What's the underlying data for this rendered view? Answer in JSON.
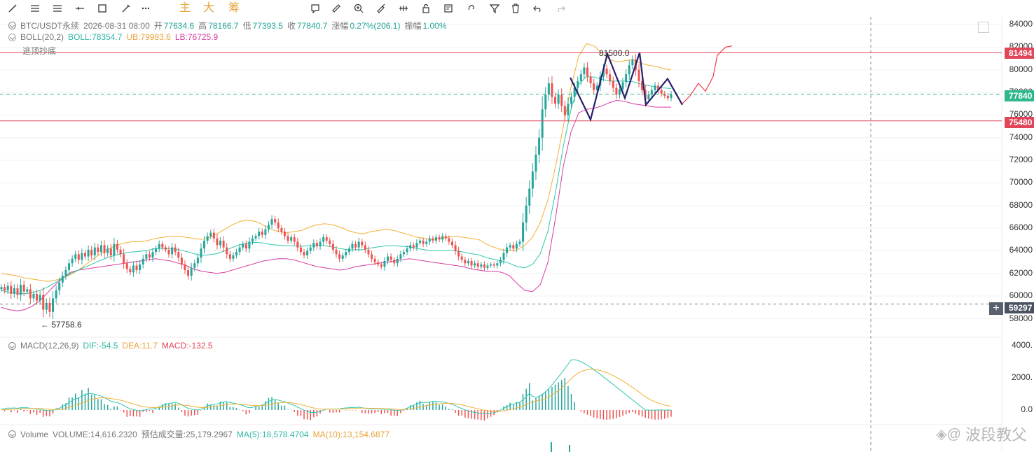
{
  "toolbar": {
    "icons": [
      "line-icon",
      "multi-line-icon",
      "parallel-lines-icon",
      "horizontal-ray-icon",
      "rectangle-icon",
      "brush-icon",
      "more-icon",
      "text-note-icon",
      "ruler-icon",
      "zoom-in-icon",
      "magnet-icon",
      "visibility-icon",
      "lock-icon",
      "note-icon",
      "link-icon",
      "filter-icon",
      "trash-icon",
      "undo-icon",
      "redo-icon"
    ],
    "labels": [
      "主",
      "大",
      "筹"
    ]
  },
  "header": {
    "symbol": "BTC/USDT永续",
    "datetime": "2026-08-31 08:00",
    "open_label": "开",
    "open": "77634.6",
    "high_label": "高",
    "high": "78166.7",
    "low_label": "低",
    "low": "77393.5",
    "close_label": "收",
    "close": "77840.7",
    "change_label": "涨幅",
    "change": "0.27%(206.1)",
    "amp_label": "振幅",
    "amp": "1.00%"
  },
  "boll": {
    "name": "BOLL(20,2)",
    "mid": "BOLL:78354.7",
    "ub": "UB:79983.6",
    "lb": "LB:76725.9",
    "indicator": "逃顶抄底"
  },
  "macd": {
    "name": "MACD(12,26,9)",
    "dif": "DIF:-54.5",
    "dea": "DEA:11.7",
    "macd": "MACD:-132.5"
  },
  "volume": {
    "name": "Volume",
    "vol": "VOLUME:14,616.2320",
    "est": "预估成交量:25,179.2967",
    "ma5": "MA(5):18,578.4704",
    "ma10": "MA(10):13,154.6877"
  },
  "price_tags": {
    "high_line": "81494",
    "current": "77840",
    "low_line": "75480",
    "cursor": "59297"
  },
  "annotations": {
    "peak": "81500.0",
    "trough": "57758.6"
  },
  "watermark": "波段教父",
  "colors": {
    "up": "#26a69a",
    "down": "#ef5350",
    "ub": "#f2b035",
    "lb": "#d63da0",
    "mid": "#2fc6ad",
    "hline": "#e0455a",
    "wave": "#2a1f6e",
    "dea": "#f2b035",
    "dif": "#2fc6ad"
  },
  "chart_data": [
    {
      "type": "candlestick",
      "title": "BTC/USDT永续",
      "y_ticks": [
        84000,
        82000,
        80000,
        78000,
        76000,
        74000,
        72000,
        70000,
        68000,
        66000,
        64000,
        62000,
        60000,
        58000
      ],
      "ylim": [
        57000,
        84600
      ],
      "close_series": [
        60800,
        60500,
        60900,
        60200,
        60700,
        60100,
        61000,
        60400,
        60600,
        59800,
        60200,
        59600,
        60100,
        58800,
        59400,
        58600,
        59800,
        60500,
        61200,
        61800,
        62300,
        62900,
        63300,
        63700,
        63200,
        63800,
        63500,
        64100,
        63600,
        64300,
        63900,
        64500,
        63800,
        64200,
        63600,
        64600,
        64100,
        63700,
        62900,
        62400,
        62100,
        62700,
        62300,
        62800,
        63300,
        63700,
        63400,
        63900,
        64200,
        64600,
        64300,
        64100,
        63700,
        64300,
        63900,
        63400,
        62800,
        62300,
        61800,
        62500,
        62900,
        63400,
        64200,
        64900,
        65300,
        65600,
        65100,
        64500,
        64900,
        64300,
        63700,
        63300,
        63600,
        63900,
        64300,
        64600,
        64200,
        64800,
        65100,
        65300,
        65700,
        65400,
        65900,
        66300,
        66800,
        66500,
        66000,
        65700,
        65300,
        64900,
        65200,
        64800,
        64300,
        63900,
        63600,
        64000,
        64300,
        64700,
        64400,
        64800,
        65200,
        64900,
        64600,
        64100,
        63700,
        63300,
        63600,
        63900,
        64200,
        64600,
        64300,
        64800,
        64500,
        64100,
        63700,
        63300,
        63000,
        62800,
        62600,
        63100,
        63500,
        63200,
        62900,
        63300,
        63700,
        63900,
        64200,
        64500,
        64300,
        64700,
        64900,
        64600,
        64800,
        65100,
        64900,
        65200,
        65000,
        65300,
        65100,
        64800,
        64500,
        64000,
        63500,
        63200,
        62900,
        63100,
        62700,
        62900,
        62600,
        62800,
        62500,
        62700,
        62800,
        62700,
        62900,
        63200,
        63800,
        64300,
        64500,
        64200,
        64600,
        64800,
        66500,
        68000,
        69500,
        71000,
        72500,
        74000,
        76500,
        77800,
        78800,
        77600,
        77000,
        77800,
        76800,
        76000,
        77000,
        77600,
        78400,
        79000,
        79600,
        80200,
        79400,
        78800,
        78200,
        78600,
        79400,
        80100,
        79600,
        79000,
        78400,
        77800,
        78300,
        78900,
        79600,
        80400,
        80900,
        80000,
        79000,
        78200,
        77400,
        77800,
        78200,
        78600,
        78200,
        77900,
        77700,
        77500,
        77840
      ],
      "boll_ub": [
        62000,
        61900,
        61800,
        61600,
        61500,
        61400,
        61300,
        61400,
        61600,
        61900,
        62300,
        62800,
        63300,
        63800,
        64200,
        64500,
        64700,
        64800,
        64800,
        64900,
        65100,
        65200,
        65300,
        65300,
        65200,
        65100,
        65000,
        65200,
        65500,
        65900,
        66300,
        66600,
        66700,
        66600,
        66300,
        65900,
        65700,
        65600,
        65700,
        65800,
        66100,
        66300,
        66400,
        66300,
        66100,
        65800,
        65600,
        65500,
        65700,
        65800,
        65900,
        65800,
        65600,
        65400,
        65200,
        65100,
        65000,
        65100,
        65200,
        65300,
        65200,
        65100,
        65000,
        64600,
        64300,
        64100,
        64000,
        64100,
        64500,
        65200,
        66500,
        68500,
        71500,
        75000,
        78500,
        81200,
        82300,
        82100,
        81500,
        80900,
        80700,
        80800,
        80900,
        80600,
        80400,
        80300,
        80100,
        80000
      ],
      "boll_lb": [
        59000,
        58800,
        58700,
        58800,
        59100,
        59600,
        60300,
        61000,
        61600,
        62100,
        62300,
        62400,
        62500,
        62600,
        62700,
        62800,
        62900,
        63000,
        63100,
        63200,
        63300,
        63200,
        63100,
        62900,
        62700,
        62400,
        62200,
        62100,
        62000,
        62100,
        62300,
        62500,
        62700,
        62900,
        63100,
        63200,
        63300,
        63300,
        63200,
        63000,
        62800,
        62600,
        62500,
        62400,
        62300,
        62400,
        62600,
        62700,
        62800,
        62900,
        63000,
        63100,
        63200,
        63300,
        63200,
        63100,
        63000,
        62900,
        62800,
        62700,
        62600,
        62400,
        62300,
        62200,
        62200,
        62100,
        61800,
        61100,
        60500,
        60400,
        61000,
        63000,
        67000,
        71500,
        74500,
        76200,
        76500,
        76600,
        76800,
        77100,
        77300,
        77200,
        77000,
        76900,
        76800,
        76700,
        76700,
        76700
      ],
      "wave": [
        [
          814,
          79300
        ],
        [
          843,
          75600
        ],
        [
          867,
          81400
        ],
        [
          892,
          77500
        ],
        [
          913,
          81500
        ],
        [
          922,
          76900
        ],
        [
          953,
          79200
        ],
        [
          974,
          76900
        ]
      ],
      "forecast": [
        [
          974,
          77000
        ],
        [
          985,
          77700
        ],
        [
          997,
          78800
        ],
        [
          1007,
          78100
        ],
        [
          1018,
          79400
        ],
        [
          1024,
          81300
        ],
        [
          1036,
          82000
        ],
        [
          1045,
          82100
        ]
      ],
      "hlines": [
        81494,
        77840,
        75480,
        59297
      ]
    },
    {
      "type": "bar",
      "title": "MACD(12,26,9)",
      "y_ticks": [
        4000,
        2000,
        0.0
      ],
      "ylim": [
        -1000,
        4600
      ]
    }
  ]
}
